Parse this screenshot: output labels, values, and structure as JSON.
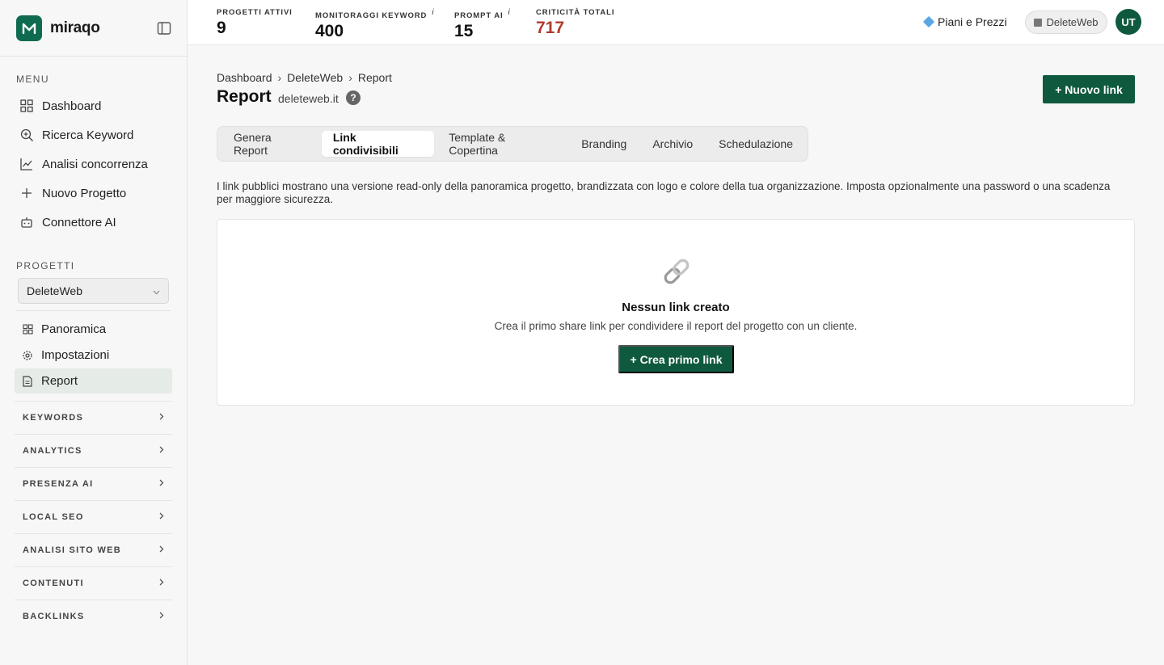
{
  "brand": {
    "name": "miraqo",
    "accent": "#0f6b4f"
  },
  "sidebar": {
    "menu_label": "MENU",
    "menu": [
      {
        "label": "Dashboard",
        "icon": "grid-icon"
      },
      {
        "label": "Ricerca Keyword",
        "icon": "search-plus-icon"
      },
      {
        "label": "Analisi concorrenza",
        "icon": "line-chart-icon"
      },
      {
        "label": "Nuovo Progetto",
        "icon": "plus-icon"
      },
      {
        "label": "Connettore AI",
        "icon": "robot-icon"
      }
    ],
    "projects_label": "PROGETTI",
    "project_selected": "DeleteWeb",
    "project_items": [
      {
        "label": "Panoramica",
        "icon": "grid-icon"
      },
      {
        "label": "Impostazioni",
        "icon": "gear-icon"
      },
      {
        "label": "Report",
        "icon": "document-icon",
        "active": true
      }
    ],
    "groups": [
      "KEYWORDS",
      "ANALYTICS",
      "PRESENZA AI",
      "LOCAL SEO",
      "ANALISI SITO WEB",
      "CONTENUTI",
      "BACKLINKS"
    ]
  },
  "topbar": {
    "stats": [
      {
        "label": "PROGETTI ATTIVI",
        "value": "9",
        "info": ""
      },
      {
        "label": "MONITORAGGI KEYWORD",
        "value": "400",
        "info": "i"
      },
      {
        "label": "PROMPT AI",
        "value": "15",
        "info": "i"
      },
      {
        "label": "CRITICITÀ TOTALI",
        "value": "717",
        "info": "",
        "color": "#b03a2e"
      }
    ],
    "pricing": "Piani e Prezzi",
    "org": "DeleteWeb",
    "avatar_initials": "UT"
  },
  "main": {
    "breadcrumb": [
      "Dashboard",
      "DeleteWeb",
      "Report"
    ],
    "breadcrumb_sep": "›",
    "title": "Report",
    "domain": "deleteweb.it",
    "help": "?",
    "new_link_button": "+ Nuovo link",
    "tabs": [
      {
        "label": "Genera Report"
      },
      {
        "label": "Link condivisibili",
        "active": true
      },
      {
        "label": "Template & Copertina"
      },
      {
        "label": "Branding"
      },
      {
        "label": "Archivio"
      },
      {
        "label": "Schedulazione"
      }
    ],
    "intro": "I link pubblici mostrano una versione read-only della panoramica progetto, brandizzata con logo e colore della tua organizzazione. Imposta opzionalmente una password o una scadenza per maggiore sicurezza.",
    "empty": {
      "icon": "link-icon",
      "title": "Nessun link creato",
      "description": "Crea il primo share link per condividere il report del progetto con un cliente.",
      "button": "+ Crea primo link"
    }
  }
}
